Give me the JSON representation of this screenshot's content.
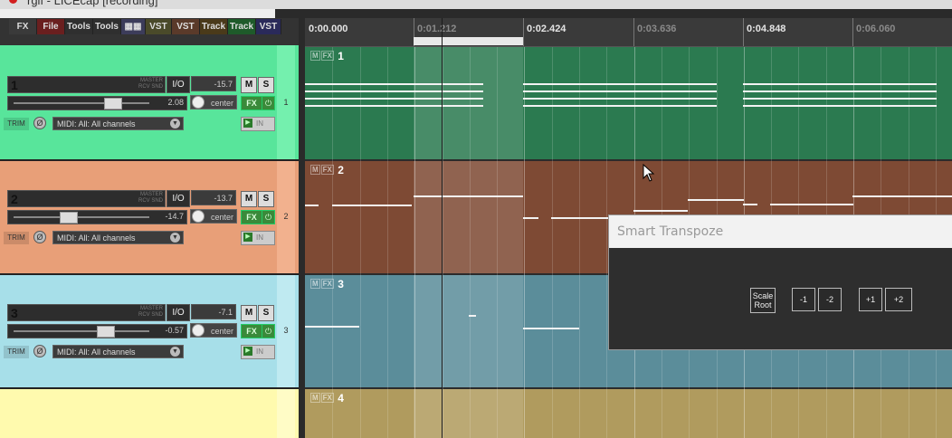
{
  "window": {
    "title": "rgif - LICEcap [recording]"
  },
  "toolbar": {
    "buttons": [
      {
        "label": "FX",
        "bg": "#3a3a3a"
      },
      {
        "label": "File",
        "bg": "#6a1f1f"
      },
      {
        "label": "Tools",
        "bg": "#2f2f2f"
      },
      {
        "label": "Tools",
        "bg": "#2f2f2f"
      },
      {
        "label": "",
        "bg": "#3c3c5a"
      },
      {
        "label": "VST",
        "bg": "#4a4a2a"
      },
      {
        "label": "VST",
        "bg": "#5a3a2a"
      },
      {
        "label": "Track",
        "bg": "#4a3a1a"
      },
      {
        "label": "Track",
        "bg": "#1e5a2a"
      },
      {
        "label": "VST",
        "bg": "#2a2a5a"
      }
    ]
  },
  "ruler": {
    "marks": [
      "0:00.000",
      "0:01.212",
      "0:02.424",
      "0:03.636",
      "0:04.848",
      "0:06.060"
    ]
  },
  "tracks": [
    {
      "number": "1",
      "master_label": "MASTER\nRCV SND",
      "io": "I/O",
      "volume": "-15.7",
      "mute": "M",
      "solo": "S",
      "fader_value": "2.08",
      "pan": "center",
      "fx": "FX",
      "trim": "TRIM",
      "midi_input": "MIDI: All: All channels",
      "arm_in": "IN",
      "meter_num": "1",
      "color": "#58e59b",
      "item_color": "#2b7a50"
    },
    {
      "number": "2",
      "master_label": "MASTER\nRCV SND",
      "io": "I/O",
      "volume": "-13.7",
      "mute": "M",
      "solo": "S",
      "fader_value": "-14.7",
      "pan": "center",
      "fx": "FX",
      "trim": "TRIM",
      "midi_input": "MIDI: All: All channels",
      "arm_in": "IN",
      "meter_num": "2",
      "color": "#e89f78",
      "item_color": "#7e4a34"
    },
    {
      "number": "3",
      "master_label": "MASTER\nRCV SND",
      "io": "I/O",
      "volume": "-7.1",
      "mute": "M",
      "solo": "S",
      "fader_value": "-0.57",
      "pan": "center",
      "fx": "FX",
      "trim": "TRIM",
      "midi_input": "MIDI: All: All channels",
      "arm_in": "IN",
      "meter_num": "3",
      "color": "#a7dfe9",
      "item_color": "#5b8d9a"
    },
    {
      "number": "4",
      "color": "#fffaae",
      "item_color": "#b09b5e"
    }
  ],
  "items": [
    {
      "label": "1"
    },
    {
      "label": "2"
    },
    {
      "label": "3"
    },
    {
      "label": "4"
    }
  ],
  "item_tags": {
    "m": "M",
    "fx": "FX"
  },
  "dialog": {
    "title": "Smart Transpoze",
    "buttons": [
      "Scale Root",
      "-1",
      "-2",
      "+1",
      "+2"
    ]
  }
}
